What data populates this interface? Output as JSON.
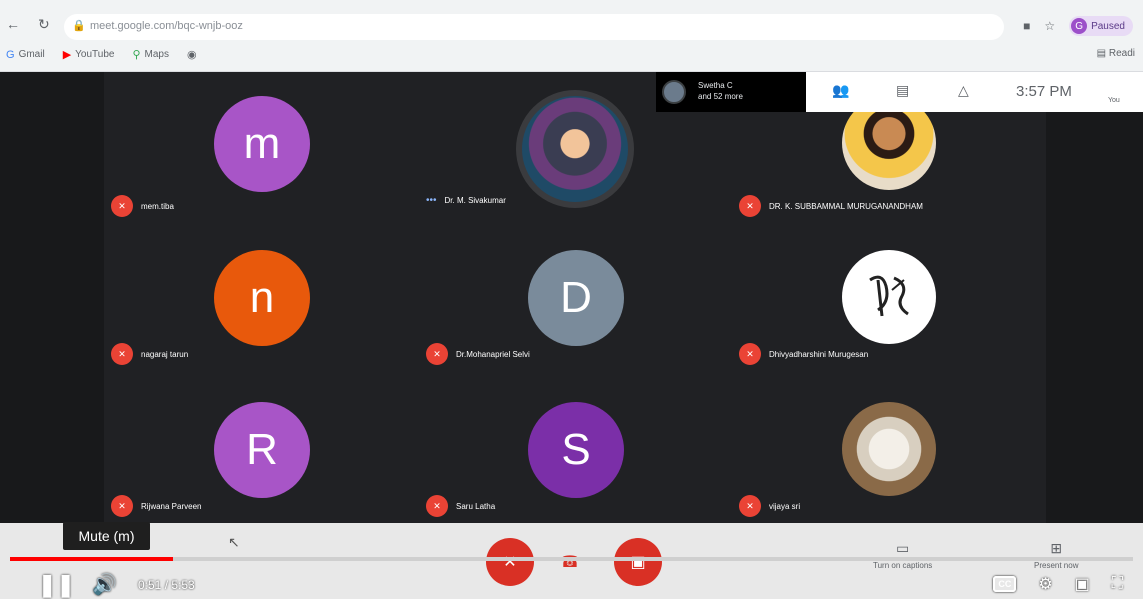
{
  "browser": {
    "url": "meet.google.com/bqc-wnjb-ooz",
    "profile_letter": "G",
    "profile_status": "Paused",
    "bookmarks": [
      {
        "label": "Gmail",
        "icon": "gmail-icon"
      },
      {
        "label": "YouTube",
        "icon": "youtube-icon"
      },
      {
        "label": "Maps",
        "icon": "maps-icon"
      }
    ],
    "reading_list": "Readi"
  },
  "meet": {
    "presenter": {
      "line1": "Swetha C",
      "line2": "and 52 more"
    },
    "time": "3:57 PM",
    "you_label": "You",
    "participants": [
      {
        "name": "mem.tiba",
        "avatar_letter": "m",
        "avatar_color": "#a855c7",
        "muted": true,
        "photo": false
      },
      {
        "name": "Dr. M. Sivakumar",
        "avatar_letter": "",
        "avatar_color": "",
        "muted": false,
        "photo": true
      },
      {
        "name": "DR. K. SUBBAMMAL MURUGANANDHAM",
        "avatar_letter": "",
        "avatar_color": "",
        "muted": true,
        "photo": true
      },
      {
        "name": "nagaraj tarun",
        "avatar_letter": "n",
        "avatar_color": "#e8590c",
        "muted": true,
        "photo": false
      },
      {
        "name": "Dr.Mohanapriel Selvi",
        "avatar_letter": "D",
        "avatar_color": "#7a8b9b",
        "muted": true,
        "photo": false
      },
      {
        "name": "Dhivyadharshini Murugesan",
        "avatar_letter": "",
        "avatar_color": "",
        "muted": true,
        "photo": true
      },
      {
        "name": "Rijwana Parveen",
        "avatar_letter": "R",
        "avatar_color": "#a855c7",
        "muted": true,
        "photo": false
      },
      {
        "name": "Saru Latha",
        "avatar_letter": "S",
        "avatar_color": "#7b2fa8",
        "muted": true,
        "photo": false
      },
      {
        "name": "vijaya sri",
        "avatar_letter": "",
        "avatar_color": "",
        "muted": true,
        "photo": true
      }
    ],
    "captions_label": "Turn on captions",
    "present_label": "Present now"
  },
  "player": {
    "tooltip": "Mute (m)",
    "time": "0:51 / 5:53",
    "progress": 0.145,
    "cc_label": "CC"
  }
}
